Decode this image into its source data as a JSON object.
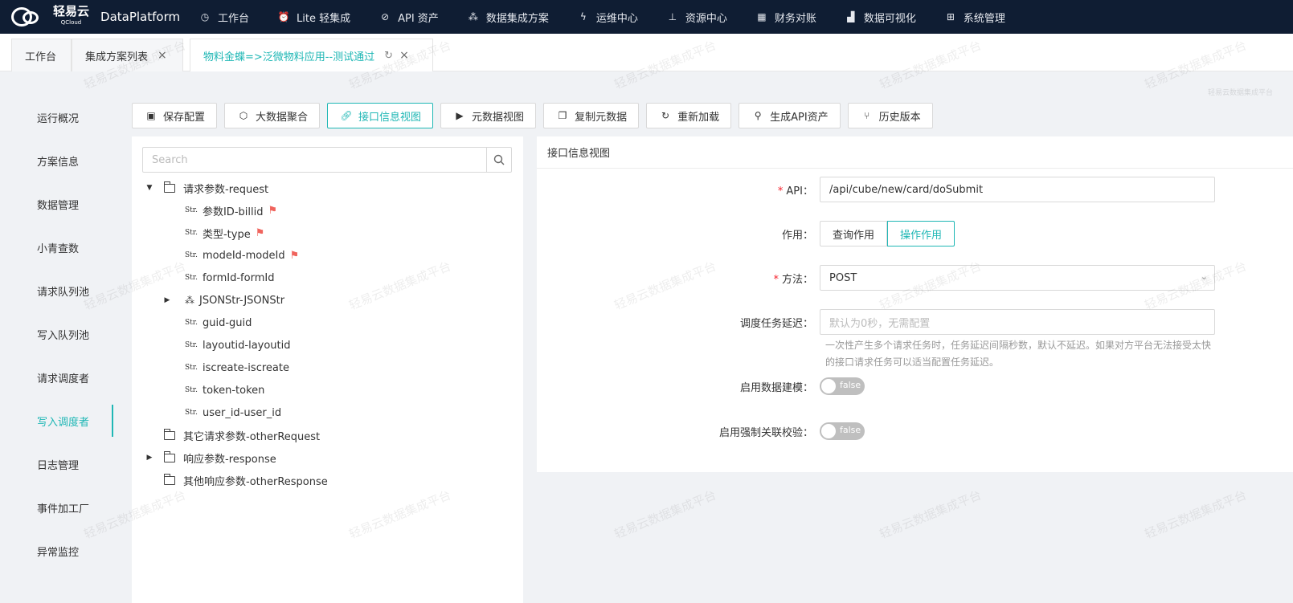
{
  "app": {
    "brand_cn": "轻易云",
    "brand_sub": "QCloud",
    "brand_en": "DataPlatform"
  },
  "nav": [
    {
      "label": "工作台",
      "icon": "clock-icon"
    },
    {
      "label": "Lite 轻集成",
      "icon": "alarm-icon"
    },
    {
      "label": "API 资产",
      "icon": "compass-icon"
    },
    {
      "label": "数据集成方案",
      "icon": "network-icon"
    },
    {
      "label": "运维中心",
      "icon": "bolt-icon"
    },
    {
      "label": "资源中心",
      "icon": "hierarchy-icon"
    },
    {
      "label": "财务对账",
      "icon": "calculator-icon"
    },
    {
      "label": "数据可视化",
      "icon": "bar-chart-icon"
    },
    {
      "label": "系统管理",
      "icon": "grid-icon"
    }
  ],
  "tabs": [
    {
      "label": "工作台"
    },
    {
      "label": "集成方案列表",
      "close": "×"
    },
    {
      "label": "物料金蝶=>泛微物料应用--测试通过",
      "refresh": "↻",
      "close": "×"
    }
  ],
  "sidebar": [
    {
      "label": "运行概况"
    },
    {
      "label": "方案信息"
    },
    {
      "label": "数据管理"
    },
    {
      "label": "小青查数"
    },
    {
      "label": "请求队列池"
    },
    {
      "label": "写入队列池"
    },
    {
      "label": "请求调度者"
    },
    {
      "label": "写入调度者",
      "active": true
    },
    {
      "label": "日志管理"
    },
    {
      "label": "事件加工厂"
    },
    {
      "label": "异常监控"
    }
  ],
  "toolbar": [
    {
      "label": "保存配置",
      "icon": "save-icon"
    },
    {
      "label": "大数据聚合",
      "icon": "cube-icon"
    },
    {
      "label": "接口信息视图",
      "icon": "link-icon",
      "active": true
    },
    {
      "label": "元数据视图",
      "icon": "terminal-icon"
    },
    {
      "label": "复制元数据",
      "icon": "copy-icon"
    },
    {
      "label": "重新加载",
      "icon": "reload-icon"
    },
    {
      "label": "生成API资产",
      "icon": "plug-icon"
    },
    {
      "label": "历史版本",
      "icon": "branch-icon"
    }
  ],
  "tree": {
    "search_placeholder": "Search",
    "str_tag": "Str.",
    "nodes": [
      {
        "label": "请求参数-request",
        "type": "folder",
        "level": 0,
        "expanded": true
      },
      {
        "label": "参数ID-billid",
        "type": "str",
        "level": 1,
        "flag": true
      },
      {
        "label": "类型-type",
        "type": "str",
        "level": 1,
        "flag": true
      },
      {
        "label": "modeId-modeId",
        "type": "str",
        "level": 1,
        "flag": true
      },
      {
        "label": "formId-formId",
        "type": "str",
        "level": 1
      },
      {
        "label": "JSONStr-JSONStr",
        "type": "object",
        "level": 1,
        "collapsed": true
      },
      {
        "label": "guid-guid",
        "type": "str",
        "level": 1
      },
      {
        "label": "layoutid-layoutid",
        "type": "str",
        "level": 1
      },
      {
        "label": "iscreate-iscreate",
        "type": "str",
        "level": 1
      },
      {
        "label": "token-token",
        "type": "str",
        "level": 1
      },
      {
        "label": "user_id-user_id",
        "type": "str",
        "level": 1
      },
      {
        "label": "其它请求参数-otherRequest",
        "type": "folder",
        "level": 0
      },
      {
        "label": "响应参数-response",
        "type": "folder",
        "level": 0,
        "collapsed": true
      },
      {
        "label": "其他响应参数-otherResponse",
        "type": "folder",
        "level": 0
      }
    ]
  },
  "form": {
    "title": "接口信息视图",
    "api_label": "API",
    "api_value": "/api/cube/new/card/doSubmit",
    "role_label": "作用",
    "role_options": [
      "查询作用",
      "操作作用"
    ],
    "role_selected": "操作作用",
    "method_label": "方法",
    "method_value": "POST",
    "delay_label": "调度任务延迟",
    "delay_placeholder": "默认为0秒，无需配置",
    "delay_help": "一次性产生多个请求任务时，任务延迟间隔秒数，默认不延迟。如果对方平台无法接受太快的接口请求任务可以适当配置任务延迟。",
    "modeling_label": "启用数据建模",
    "modeling_value": "false",
    "strict_label": "启用强制关联校验",
    "strict_value": "false",
    "colon": "："
  },
  "watermark": {
    "text": "轻易云数据集成平台"
  },
  "colors": {
    "accent": "#1fb7b5",
    "topbar": "#0f1d33",
    "flag": "#f0645d",
    "required": "#f5222d"
  }
}
